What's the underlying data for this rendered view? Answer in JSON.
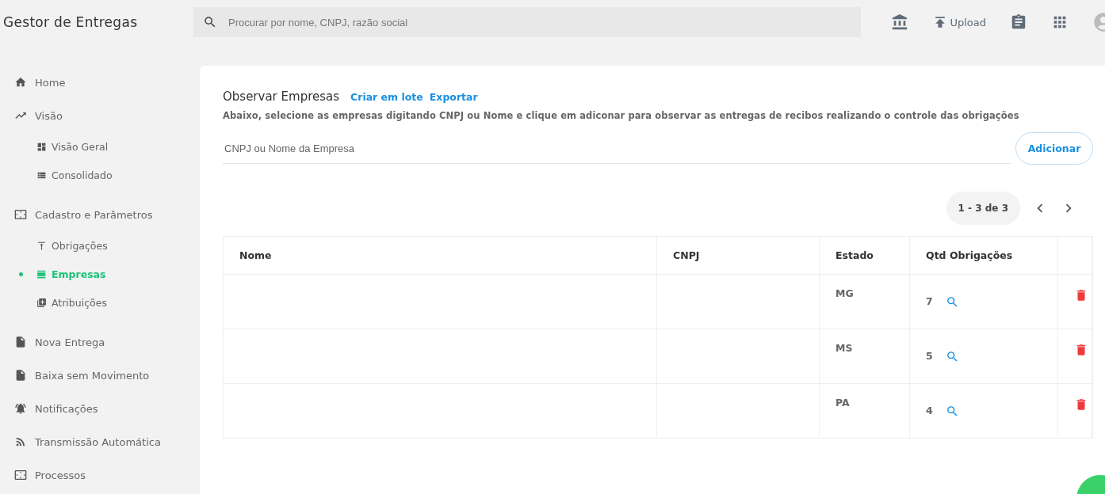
{
  "app_title": "Gestor de Entregas",
  "search": {
    "placeholder": "Procurar por nome, CNPJ, razão social"
  },
  "toolbar": {
    "upload_label": "Upload"
  },
  "sidebar": {
    "items": [
      {
        "label": "Home",
        "selected": false
      },
      {
        "label": "Visão",
        "selected": false,
        "children": [
          {
            "label": "Visão Geral",
            "selected": false
          },
          {
            "label": "Consolidado",
            "selected": false
          }
        ]
      },
      {
        "label": "Cadastro e Parâmetros",
        "selected": false,
        "children": [
          {
            "label": "Obrigações",
            "selected": false
          },
          {
            "label": "Empresas",
            "selected": true
          },
          {
            "label": "Atribuições",
            "selected": false
          }
        ]
      },
      {
        "label": "Nova Entrega",
        "selected": false
      },
      {
        "label": "Baixa sem Movimento",
        "selected": false
      },
      {
        "label": "Notificações",
        "selected": false
      },
      {
        "label": "Transmissão Automática",
        "selected": false
      },
      {
        "label": "Processos",
        "selected": false
      }
    ]
  },
  "page": {
    "title": "Observar Empresas",
    "links": [
      "Criar em lote",
      "Exportar"
    ],
    "description": "Abaixo, selecione as empresas digitando CNPJ ou Nome e clique em adiconar para observar as entregas de recibos realizando o controle das obrigações",
    "input": {
      "placeholder": "CNPJ ou Nome da Empresa"
    },
    "add_button": "Adicionar"
  },
  "pagination": {
    "range": "1 - 3 de 3"
  },
  "table": {
    "columns": [
      "Nome",
      "CNPJ",
      "Estado",
      "Qtd Obrigações"
    ],
    "rows": [
      {
        "estado": "MG",
        "qtd": "7"
      },
      {
        "estado": "MS",
        "qtd": "5"
      },
      {
        "estado": "PA",
        "qtd": "4"
      }
    ]
  }
}
